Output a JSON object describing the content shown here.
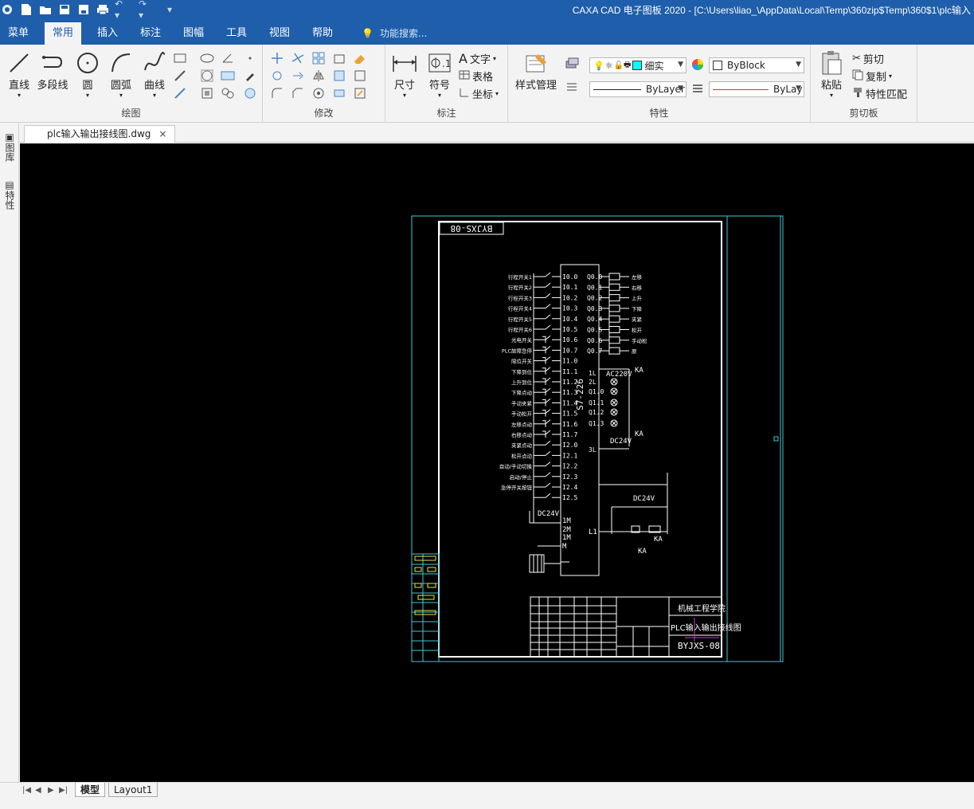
{
  "window": {
    "title": "CAXA CAD 电子图板 2020 - [C:\\Users\\liao_\\AppData\\Local\\Temp\\360zip$Temp\\360$1\\plc输入"
  },
  "ribbon_tabs": [
    "菜单",
    "常用",
    "插入",
    "标注",
    "图幅",
    "工具",
    "视图",
    "帮助"
  ],
  "active_tab": "常用",
  "search_placeholder": "功能搜索...",
  "groups": {
    "draw": {
      "label": "绘图",
      "buttons": [
        "直线",
        "多段线",
        "圆",
        "圆弧",
        "曲线"
      ]
    },
    "modify": {
      "label": "修改"
    },
    "annotate": {
      "label": "标注",
      "buttons": [
        "尺寸",
        "符号"
      ],
      "text_buttons": [
        "文字",
        "表格",
        "坐标"
      ]
    },
    "properties": {
      "label": "特性",
      "style_button": "样式管理",
      "layer_value": "细实",
      "color_value": "ByBlock",
      "linetype_value": "ByLayer",
      "lineweight_value": "ByLay"
    },
    "clipboard": {
      "label": "剪切板",
      "paste": "粘贴",
      "items": [
        "剪切",
        "复制",
        "特性匹配"
      ]
    }
  },
  "document": {
    "tab_label": "plc输入输出接线图.dwg",
    "close": "×"
  },
  "sidebar": {
    "items": [
      "图库",
      "特性"
    ]
  },
  "layout_tabs": [
    "模型",
    "Layout1"
  ],
  "drawing": {
    "drawing_code": "BYJXS-08",
    "plc_model": "S7-226",
    "inputs": [
      "I0.0",
      "I0.1",
      "I0.2",
      "I0.3",
      "I0.4",
      "I0.5",
      "I0.6",
      "I0.7",
      "I1.0",
      "I1.1",
      "I1.2",
      "I1.3",
      "I1.4",
      "I1.5",
      "I1.6",
      "I1.7",
      "I2.0",
      "I2.1",
      "I2.2",
      "I2.3",
      "I2.4",
      "I2.5"
    ],
    "outputs": [
      "Q0.0",
      "Q0.1",
      "Q0.2",
      "Q0.3",
      "Q0.4",
      "Q0.5",
      "Q0.6",
      "Q0.7"
    ],
    "outputs2": [
      "1L",
      "2L",
      "Q1.0",
      "Q1.1",
      "Q1.2",
      "Q1.3",
      "3L"
    ],
    "input_labels": [
      "行程开关1",
      "行程开关2",
      "行程开关3",
      "行程开关4",
      "行程开关5",
      "行程开关6",
      "光电开关",
      "PLC故障急停",
      "限位开关",
      "下降到位",
      "上升到位",
      "下降点动",
      "手动夹紧",
      "手动松开",
      "左移点动",
      "右移点动",
      "夹紧点动",
      "松开点动",
      "自动/手动切换",
      "启动/停止",
      "急停开关按钮"
    ],
    "output_labels": [
      "左移",
      "右移",
      "上升",
      "下降",
      "夹紧",
      "松开",
      "手动松",
      "原"
    ],
    "voltages": [
      "AC220V",
      "DC24V",
      "DC24V",
      "DC24V"
    ],
    "relay": "KA",
    "labels": [
      "1M",
      "2M",
      "1M",
      "M",
      "L1"
    ],
    "school": "机械工程学院",
    "drawing_title": "PLC输入输出接线图"
  },
  "colors": {
    "titlebar": "#1e5eaa",
    "canvas": "#000000",
    "cyan_border": "#3ec7d6",
    "white_frame": "#ffffff"
  }
}
